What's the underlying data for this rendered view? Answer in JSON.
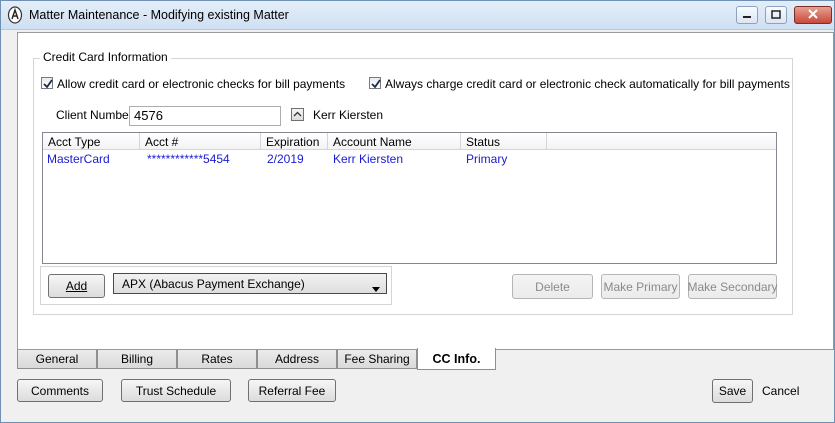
{
  "window": {
    "title": "Matter Maintenance - Modifying existing Matter",
    "minimize_icon": "minimize-icon",
    "maximize_icon": "maximize-icon",
    "close_icon": "close-icon"
  },
  "credit_card": {
    "group_title": "Credit Card Information",
    "allow_checkbox_label": "Allow credit card or electronic checks for bill payments",
    "allow_checked": true,
    "always_checkbox_label": "Always charge credit card or electronic check automatically for bill payments",
    "always_checked": true,
    "client_number_label": "Client Number",
    "client_number_value": "4576",
    "client_name": "Kerr Kiersten"
  },
  "grid": {
    "columns": [
      "Acct Type",
      "Acct #",
      "Expiration",
      "Account Name",
      "Status"
    ],
    "rows": [
      [
        "MasterCard",
        "************5454",
        "2/2019",
        "Kerr Kiersten",
        "Primary"
      ]
    ]
  },
  "actions": {
    "add_label": "Add",
    "processor_selected": "APX (Abacus Payment Exchange)",
    "delete_label": "Delete",
    "make_primary_label": "Make Primary",
    "make_secondary_label": "Make Secondary"
  },
  "tabs": [
    {
      "label": "General",
      "active": false
    },
    {
      "label": "Billing",
      "active": false
    },
    {
      "label": "Rates",
      "active": false
    },
    {
      "label": "Address",
      "active": false
    },
    {
      "label": "Fee Sharing",
      "active": false
    },
    {
      "label": "CC Info.",
      "active": true
    }
  ],
  "footer": {
    "comments_label": "Comments",
    "trust_schedule_label": "Trust Schedule",
    "referral_fee_label": "Referral Fee",
    "save_label": "Save",
    "cancel_label": "Cancel"
  }
}
